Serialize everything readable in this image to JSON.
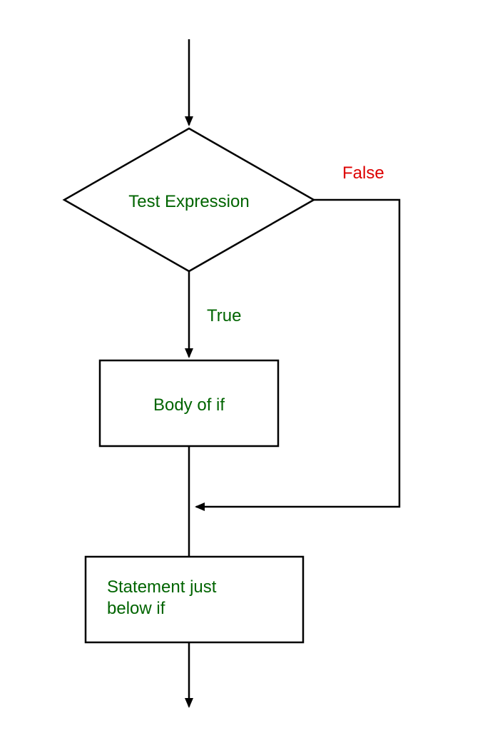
{
  "diagram": {
    "decision_label": "Test Expression",
    "true_label": "True",
    "false_label": "False",
    "body_label": "Body of if",
    "statement_label_line1": "Statement just",
    "statement_label_line2": "below if"
  }
}
